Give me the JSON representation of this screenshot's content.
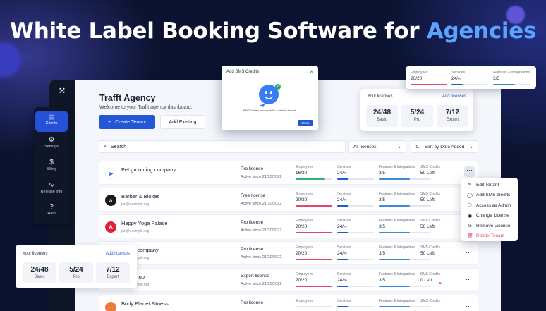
{
  "headline": {
    "text": "White Label Booking Software for ",
    "accent": "Agencies"
  },
  "sidebar": {
    "items": [
      {
        "label": "Clients",
        "icon": "briefcase-icon",
        "glyph": "▤",
        "active": true
      },
      {
        "label": "Settings",
        "icon": "gear-icon",
        "glyph": "⚙",
        "active": false
      },
      {
        "label": "Billing",
        "icon": "dollar-icon",
        "glyph": "$",
        "active": false
      },
      {
        "label": "Release Info",
        "icon": "pulse-icon",
        "glyph": "∿",
        "active": false
      },
      {
        "label": "Help",
        "icon": "help-icon",
        "glyph": "?",
        "active": false
      }
    ]
  },
  "dashboard": {
    "title": "Trafft Agency",
    "subtitle": "Welcome to your Trafft agency dashboard.",
    "create_label": "Create Tenant",
    "add_existing_label": "Add Existing"
  },
  "licenses": {
    "heading": "Your licenses",
    "add_label": "Add licenses",
    "items": [
      {
        "value": "24/48",
        "type": "Basic"
      },
      {
        "value": "5/24",
        "type": "Pro"
      },
      {
        "value": "7/12",
        "type": "Expert"
      }
    ]
  },
  "filters": {
    "search_placeholder": "Search",
    "license_filter": "All licenses",
    "sort": "Sort by Date Added"
  },
  "columns": {
    "employees": "Employees",
    "services": "Services",
    "features": "Features & Integrations",
    "sms": "SMS Credits"
  },
  "rows": [
    {
      "name": "Pet grooming company",
      "email": "",
      "license": "Pro license",
      "active": "Active since 21/20/2022",
      "employees": "16/20",
      "emp_pct": 0.8,
      "emp_color": "#2ab37a",
      "services": "24/∞",
      "features": "3/5",
      "sms": "50 Left",
      "logo": "➤",
      "logo_bg": "#ffffff",
      "logo_fg": "#2457d6"
    },
    {
      "name": "Barber & Blokes",
      "email": "jan@example.org",
      "license": "Free license",
      "active": "Active since 21/20/2022",
      "employees": "20/20",
      "emp_pct": 1,
      "emp_color": "#e5456a",
      "services": "24/∞",
      "features": "3/5",
      "sms": "50 Left",
      "logo": "a",
      "logo_bg": "#1a1a1a",
      "logo_fg": "#ffffff"
    },
    {
      "name": "Happy Yoga Palace",
      "email": "jan@example.org",
      "license": "Pro license",
      "active": "Active since 21/20/2022",
      "employees": "20/20",
      "emp_pct": 1,
      "emp_color": "#e5456a",
      "services": "24/∞",
      "features": "3/5",
      "sms": "50 Left",
      "logo": "A",
      "logo_bg": "#e0213b",
      "logo_fg": "#ffffff"
    },
    {
      "name": "g HIIT company",
      "email": "jan@example.org",
      "license": "Pro license",
      "active": "Active since 21/20/2022",
      "employees": "20/20",
      "emp_pct": 1,
      "emp_color": "#e5456a",
      "services": "24/∞",
      "features": "3/5",
      "sms": "50 Left",
      "logo": "",
      "logo_bg": "#ffffff",
      "logo_fg": "#ffffff"
    },
    {
      "name": "rber Shop",
      "email": "jan@example.org",
      "license": "Expert license",
      "active": "Active since 21/20/2022",
      "employees": "20/20",
      "emp_pct": 1,
      "emp_color": "#e5456a",
      "services": "24/∞",
      "features": "3/5",
      "sms": "0 Left",
      "logo": "",
      "logo_bg": "#ffffff",
      "logo_fg": "#ffffff"
    },
    {
      "name": "Body Planet Fitness",
      "email": "",
      "license": "Pro license",
      "active": "",
      "employees": "",
      "emp_pct": 0,
      "emp_color": "#e5456a",
      "services": "",
      "features": "",
      "sms": "",
      "logo": "",
      "logo_bg": "#f07a3a",
      "logo_fg": "#ffffff"
    }
  ],
  "menu": {
    "items": [
      {
        "label": "Edit Tenant",
        "icon": "pencil-icon",
        "glyph": "✎",
        "danger": false
      },
      {
        "label": "Add SMS credits",
        "icon": "message-icon",
        "glyph": "◯",
        "danger": false
      },
      {
        "label": "Access as Admin",
        "icon": "admin-icon",
        "glyph": "⚇",
        "danger": false
      },
      {
        "label": "Change License",
        "icon": "license-icon",
        "glyph": "◉",
        "danger": false
      },
      {
        "label": "Remove License",
        "icon": "remove-icon",
        "glyph": "⊘",
        "danger": false
      },
      {
        "label": "Delete Tenant",
        "icon": "trash-icon",
        "glyph": "🗑",
        "danger": true
      }
    ]
  },
  "modal": {
    "title": "Add SMS Credits",
    "message": "SMS Credits successfully added to tenant.",
    "ok_label": "Close"
  },
  "topcard": {
    "employees": "20/20",
    "services": "24/∞",
    "features": "3/5"
  },
  "colors": {
    "accent": "#2457d6",
    "headline_accent": "#5aa4ff",
    "danger": "#e5456a",
    "success": "#2ab37a"
  }
}
